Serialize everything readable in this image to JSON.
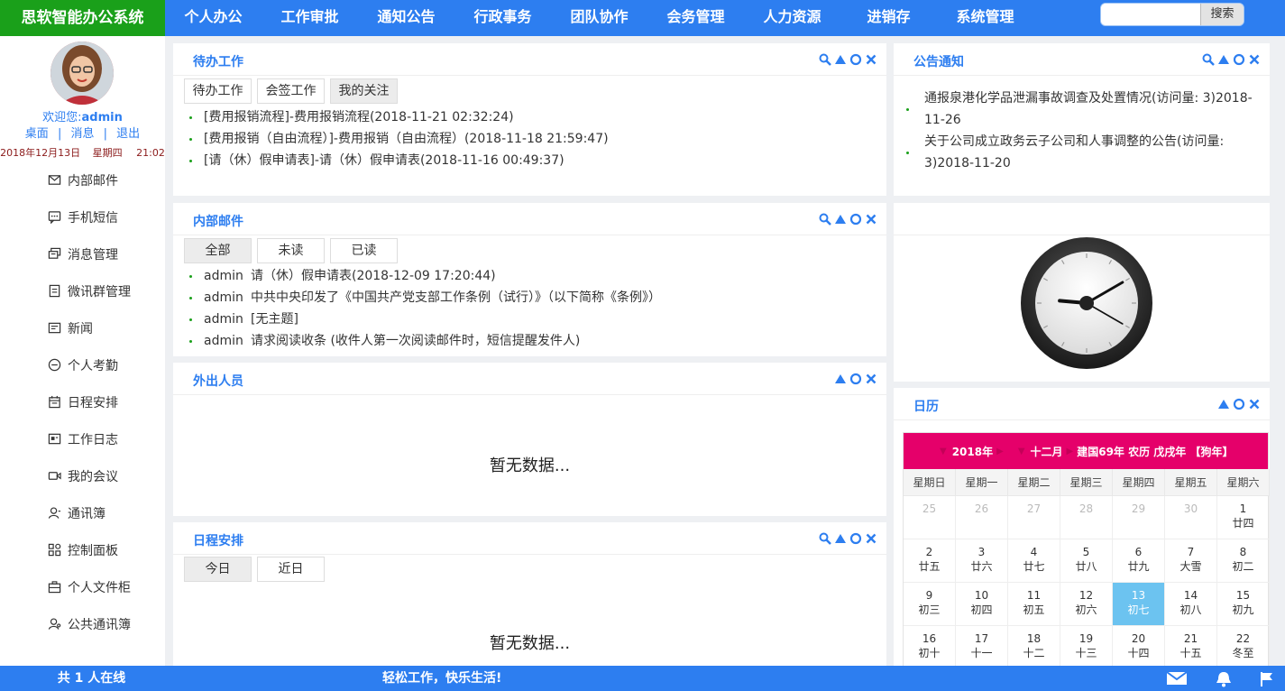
{
  "app": {
    "title": "思软智能办公系统"
  },
  "nav": [
    "个人办公",
    "工作审批",
    "通知公告",
    "行政事务",
    "团队协作",
    "会务管理",
    "人力资源",
    "进销存",
    "系统管理"
  ],
  "search": {
    "placeholder": "",
    "button": "搜索"
  },
  "user": {
    "welcome_prefix": "欢迎您:",
    "name": "admin"
  },
  "quick_links": {
    "desktop": "桌面",
    "sep": "|",
    "messages": "消息",
    "logout": "退出"
  },
  "date_line": {
    "date": "2018年12月13日",
    "weekday": "星期四",
    "time": "21:02"
  },
  "sidebar": [
    {
      "label": "内部邮件",
      "icon": "mail-icon"
    },
    {
      "label": "手机短信",
      "icon": "sms-icon"
    },
    {
      "label": "消息管理",
      "icon": "message-icon"
    },
    {
      "label": "微讯群管理",
      "icon": "group-icon"
    },
    {
      "label": "新闻",
      "icon": "news-icon"
    },
    {
      "label": "个人考勤",
      "icon": "attendance-icon"
    },
    {
      "label": "日程安排",
      "icon": "calendar-icon"
    },
    {
      "label": "工作日志",
      "icon": "log-icon"
    },
    {
      "label": "我的会议",
      "icon": "meeting-icon"
    },
    {
      "label": "通讯簿",
      "icon": "contacts-icon"
    },
    {
      "label": "控制面板",
      "icon": "dashboard-icon"
    },
    {
      "label": "个人文件柜",
      "icon": "briefcase-icon"
    },
    {
      "label": "公共通讯簿",
      "icon": "public-contacts-icon"
    }
  ],
  "todo": {
    "title": "待办工作",
    "tabs": [
      "待办工作",
      "会签工作",
      "我的关注"
    ],
    "active_tab": 2,
    "items": [
      "[费用报销流程]-费用报销流程(2018-11-21 02:32:24)",
      "[费用报销（自由流程）]-费用报销（自由流程）(2018-11-18 21:59:47)",
      "[请（休）假申请表]-请（休）假申请表(2018-11-16 00:49:37)"
    ]
  },
  "mail": {
    "title": "内部邮件",
    "tabs": [
      "全部",
      "未读",
      "已读"
    ],
    "active_tab": 0,
    "items": [
      {
        "from": "admin",
        "subject": "请（休）假申请表(2018-12-09 17:20:44)"
      },
      {
        "from": "admin",
        "subject": "中共中央印发了《中国共产党支部工作条例（试行）》（以下简称《条例》）"
      },
      {
        "from": "admin",
        "subject": "[无主题]"
      },
      {
        "from": "admin",
        "subject": "请求阅读收条 (收件人第一次阅读邮件时，短信提醒发件人)"
      }
    ]
  },
  "outing": {
    "title": "外出人员",
    "empty": "暂无数据..."
  },
  "schedule": {
    "title": "日程安排",
    "tabs": [
      "今日",
      "近日"
    ],
    "active_tab": 0,
    "empty": "暂无数据..."
  },
  "notice": {
    "title": "公告通知",
    "items": [
      "通报泉港化学品泄漏事故调查及处置情况(访问量: 3)2018-11-26",
      "关于公司成立政务云子公司和人事调整的公告(访问量: 3)2018-11-20"
    ]
  },
  "clock": {
    "hour": 9,
    "minute": 10,
    "second": 20
  },
  "calendar": {
    "title": "日历",
    "year": "2018年",
    "month": "十二月",
    "lunar_info": "建国69年 农历 戊戌年 【狗年】",
    "weekdays": [
      "星期日",
      "星期一",
      "星期二",
      "星期三",
      "星期四",
      "星期五",
      "星期六"
    ],
    "cells": [
      {
        "d": "25",
        "l": "",
        "other": true
      },
      {
        "d": "26",
        "l": "",
        "other": true
      },
      {
        "d": "27",
        "l": "",
        "other": true
      },
      {
        "d": "28",
        "l": "",
        "other": true
      },
      {
        "d": "29",
        "l": "",
        "other": true
      },
      {
        "d": "30",
        "l": "",
        "other": true
      },
      {
        "d": "1",
        "l": "廿四"
      },
      {
        "d": "2",
        "l": "廿五"
      },
      {
        "d": "3",
        "l": "廿六"
      },
      {
        "d": "4",
        "l": "廿七"
      },
      {
        "d": "5",
        "l": "廿八"
      },
      {
        "d": "6",
        "l": "廿九"
      },
      {
        "d": "7",
        "l": "大雪"
      },
      {
        "d": "8",
        "l": "初二"
      },
      {
        "d": "9",
        "l": "初三"
      },
      {
        "d": "10",
        "l": "初四"
      },
      {
        "d": "11",
        "l": "初五"
      },
      {
        "d": "12",
        "l": "初六"
      },
      {
        "d": "13",
        "l": "初七",
        "today": true
      },
      {
        "d": "14",
        "l": "初八"
      },
      {
        "d": "15",
        "l": "初九"
      },
      {
        "d": "16",
        "l": "初十"
      },
      {
        "d": "17",
        "l": "十一"
      },
      {
        "d": "18",
        "l": "十二"
      },
      {
        "d": "19",
        "l": "十三"
      },
      {
        "d": "20",
        "l": "十四"
      },
      {
        "d": "21",
        "l": "十五"
      },
      {
        "d": "22",
        "l": "冬至"
      }
    ]
  },
  "footer": {
    "online": "共 1 人在线",
    "slogan": "轻松工作，快乐生活!"
  },
  "colors": {
    "primary": "#2d7ef0",
    "logo_bg": "#1aa01a",
    "calendar_header": "#e5006a",
    "today_bg": "#6cc3f0"
  }
}
